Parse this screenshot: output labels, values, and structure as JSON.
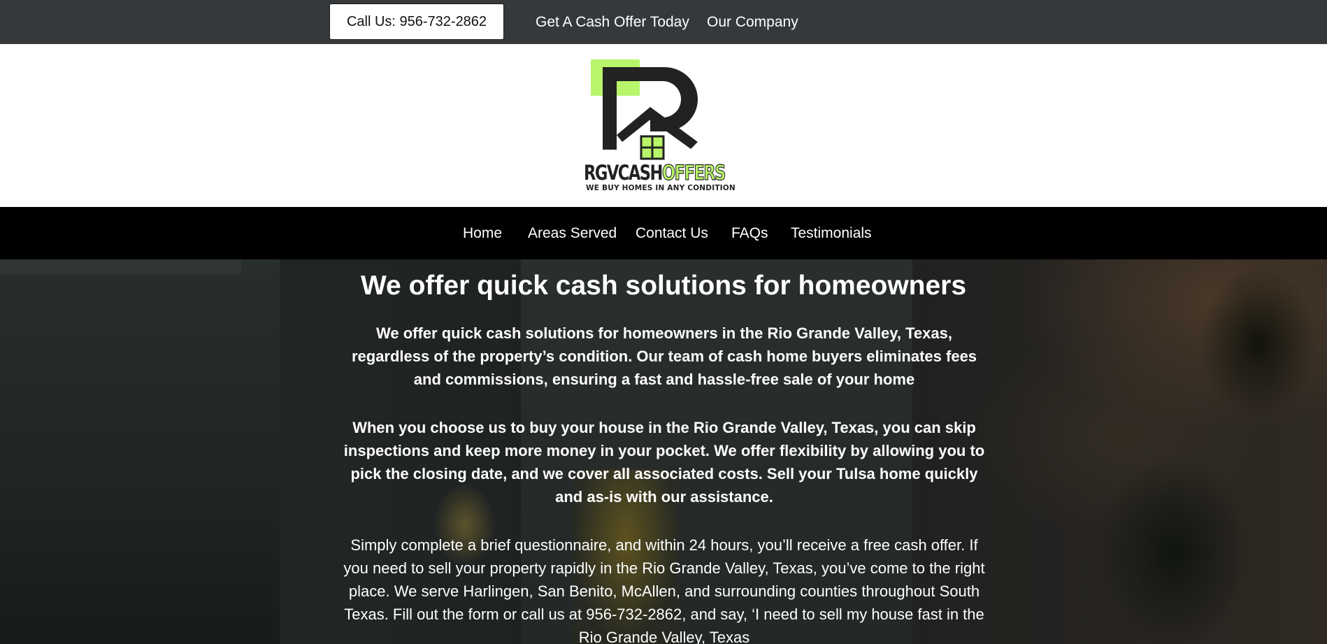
{
  "topbar": {
    "call_label": "Call Us: 956-732-2862",
    "links": [
      "Get A Cash Offer Today",
      "Our Company"
    ]
  },
  "logo": {
    "word_dark": "RGVCASH",
    "word_green": "OFFERS",
    "tagline": "WE BUY HOMES IN ANY CONDITION",
    "accent_color": "#b8f56a",
    "dark_color": "#222222"
  },
  "nav": {
    "items": [
      "Home",
      "Areas Served",
      "Contact Us",
      "FAQs",
      "Testimonials"
    ]
  },
  "hero": {
    "title": "We offer quick cash solutions for homeowners",
    "paragraph1": "We offer quick cash solutions for homeowners in the Rio Grande Valley, Texas, regardless of the property’s condition. Our team of cash home buyers eliminates fees and commissions, ensuring a fast and hassle-free sale of your home",
    "paragraph2": "When you choose us to buy your house in the Rio Grande Valley, Texas, you can skip inspections and keep more money in your pocket. We offer flexibility by allowing you to pick the closing date, and we cover all associated costs. Sell your Tulsa home quickly and as-is with our assistance.",
    "paragraph3": "Simply complete a brief questionnaire, and within 24 hours, you’ll receive a free cash offer. If you need to sell your property rapidly in the Rio Grande Valley, Texas, you’ve come to the right place. We serve Harlingen, San Benito, McAllen, and surrounding counties throughout South Texas. Fill out the form or call us at 956-732-2862, and say, ‘I need to sell my house fast in the Rio Grande Valley, Texas"
  }
}
